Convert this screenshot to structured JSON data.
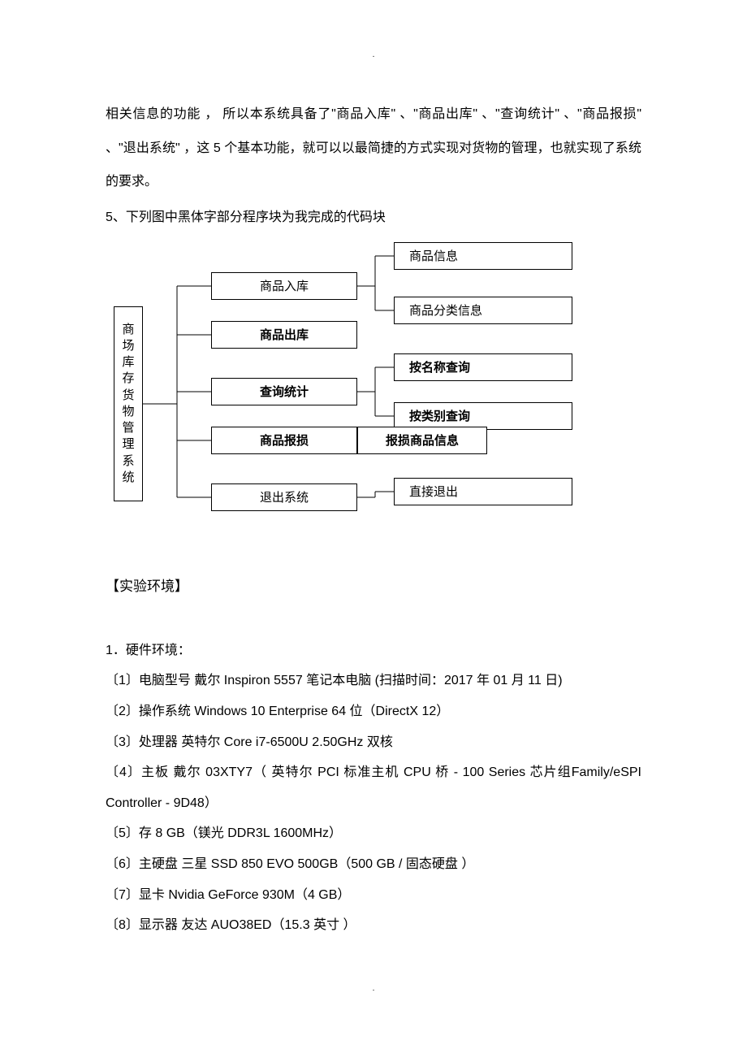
{
  "topmark": ".",
  "bottommark": ".",
  "intro_para": "相关信息的功能 ，  所以本系统具备了\"商品入库\" 、\"商品出库\" 、\"查询统计\" 、\"商品报损\" 、\"退出系统\" ，这 5 个基本功能，就可以以最简捷的方式实现对货物的管理，也就实现了系统的要求。",
  "heading5": "5、下列图中黑体字部分程序块为我完成的代码块",
  "diagram": {
    "root": "商场库存货物管理系统",
    "mid": [
      {
        "label": "商品入库",
        "bold": false
      },
      {
        "label": "商品出库",
        "bold": true
      },
      {
        "label": "查询统计",
        "bold": true
      },
      {
        "label": "商品报损",
        "bold": true
      },
      {
        "label": "退出系统",
        "bold": false
      }
    ],
    "leaves_top": [
      {
        "label": "商品信息",
        "bold": false
      },
      {
        "label": "商品分类信息",
        "bold": false
      }
    ],
    "leaves_query": [
      {
        "label": "按名称查询",
        "bold": true
      },
      {
        "label": "按类别查询",
        "bold": true
      }
    ],
    "leaf_damage": {
      "label": "报损商品信息",
      "bold": true
    },
    "leaf_exit": {
      "label": "直接退出",
      "bold": false
    }
  },
  "section_env_title": "【实验环境】",
  "env_header": "1．硬件环境：",
  "env_items": [
    "〔1〕电脑型号     戴尔  Inspiron 5557  笔记本电脑   (扫描时间：2017 年 01 月 11 日)",
    "〔2〕操作系统     Windows 10 Enterprise 64 位（DirectX 12）",
    "〔3〕处理器  英特尔  Core i7-6500U   2.50GHz  双核",
    "〔4〕主板     戴尔  03XTY7（ 英特尔  PCI  标准主机  CPU  桥  -  100  Series  芯片组Family/eSPI Controller - 9D48）",
    "〔5〕存  8 GB（镁光  DDR3L 1600MHz）",
    "〔6〕主硬盘  三星  SSD 850 EVO 500GB（500 GB /  固态硬盘 ）",
    "〔7〕显卡     Nvidia GeForce 930M（4 GB）",
    "〔8〕显示器  友达  AUO38ED（15.3  英寸   ）"
  ]
}
